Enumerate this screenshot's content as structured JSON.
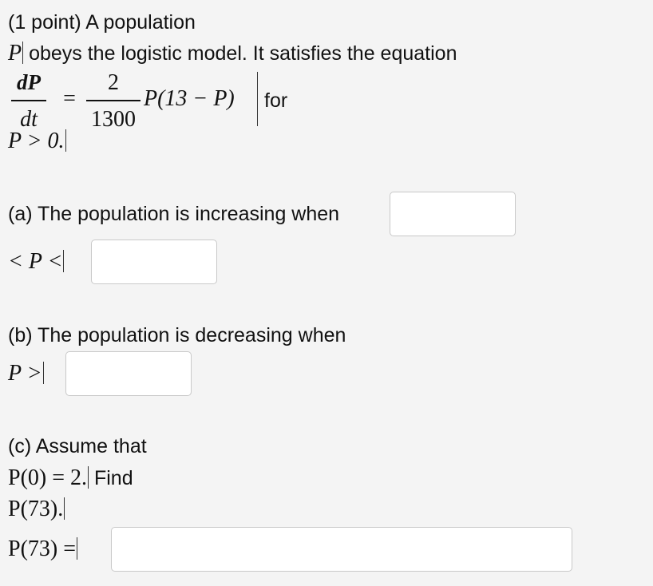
{
  "problem": {
    "points": "(1 point) A population",
    "line2_var": "P",
    "line2_text": "obeys the logistic model. It satisfies the equation",
    "eq_lhs_num": "dP",
    "eq_lhs_den": "dt",
    "eq_equals": "=",
    "eq_rhs_num": "2",
    "eq_rhs_den": "1300",
    "eq_tail": "P(13 − P)",
    "eq_for": "for",
    "condition": "P > 0."
  },
  "part_a": {
    "prompt": "(a) The population is increasing when",
    "middle": "< P <",
    "lower_value": "",
    "upper_value": ""
  },
  "part_b": {
    "prompt": "(b) The population is decreasing when",
    "math": "P >",
    "value": ""
  },
  "part_c": {
    "prompt": "(c) Assume that",
    "given": "P(0) = 2.",
    "find": "Find",
    "target": "P(73).",
    "answer_label": "P(73) =",
    "value": ""
  }
}
